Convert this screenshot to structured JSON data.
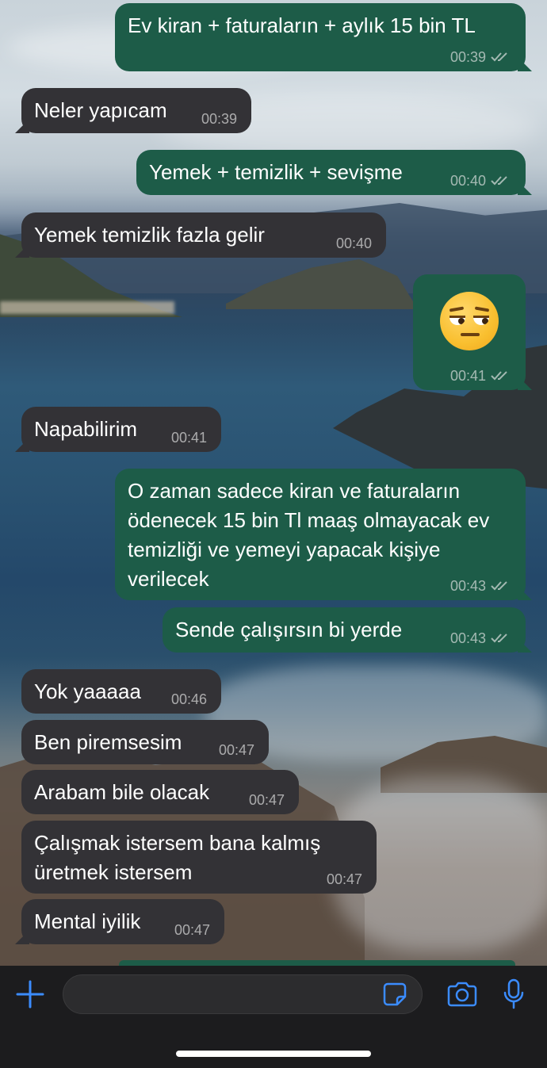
{
  "theme": {
    "incoming_bubble": "#333236",
    "outgoing_bubble": "#1d5c48",
    "accent": "#3b8cff",
    "input_bar": "#1c1c1e"
  },
  "messages": [
    {
      "direction": "out",
      "text": "Ev kiran + faturaların + aylık 15 bin TL",
      "time": "00:39",
      "status": "read"
    },
    {
      "direction": "in",
      "text": "Neler yapıcam",
      "time": "00:39"
    },
    {
      "direction": "out",
      "text": "Yemek + temizlik + sevişme",
      "time": "00:40",
      "status": "read"
    },
    {
      "direction": "in",
      "text": "Yemek temizlik fazla gelir",
      "time": "00:40"
    },
    {
      "direction": "out",
      "emoji": "unamused-face",
      "time": "00:41",
      "status": "read"
    },
    {
      "direction": "in",
      "text": "Napabilirim",
      "time": "00:41"
    },
    {
      "direction": "out",
      "text": "O zaman sadece kiran ve faturaların ödenecek 15 bin Tl maaş olmayacak ev temizliği ve yemeyi yapacak kişiye verilecek",
      "time": "00:43",
      "status": "read"
    },
    {
      "direction": "out",
      "text": "Sende çalışırsın bi yerde",
      "time": "00:43",
      "status": "read"
    },
    {
      "direction": "in",
      "text": "Yok yaaaaa",
      "time": "00:46"
    },
    {
      "direction": "in",
      "text": "Ben piremsesim",
      "time": "00:47"
    },
    {
      "direction": "in",
      "text": "Arabam bile olacak",
      "time": "00:47"
    },
    {
      "direction": "in",
      "text": "Çalışmak istersem bana kalmış üretmek istersem",
      "time": "00:47"
    },
    {
      "direction": "in",
      "text": "Mental iyilik",
      "time": "00:47"
    }
  ],
  "input_bar": {
    "icons": [
      "plus-icon",
      "sticker-icon",
      "camera-icon",
      "microphone-icon"
    ],
    "message_field_placeholder": ""
  }
}
